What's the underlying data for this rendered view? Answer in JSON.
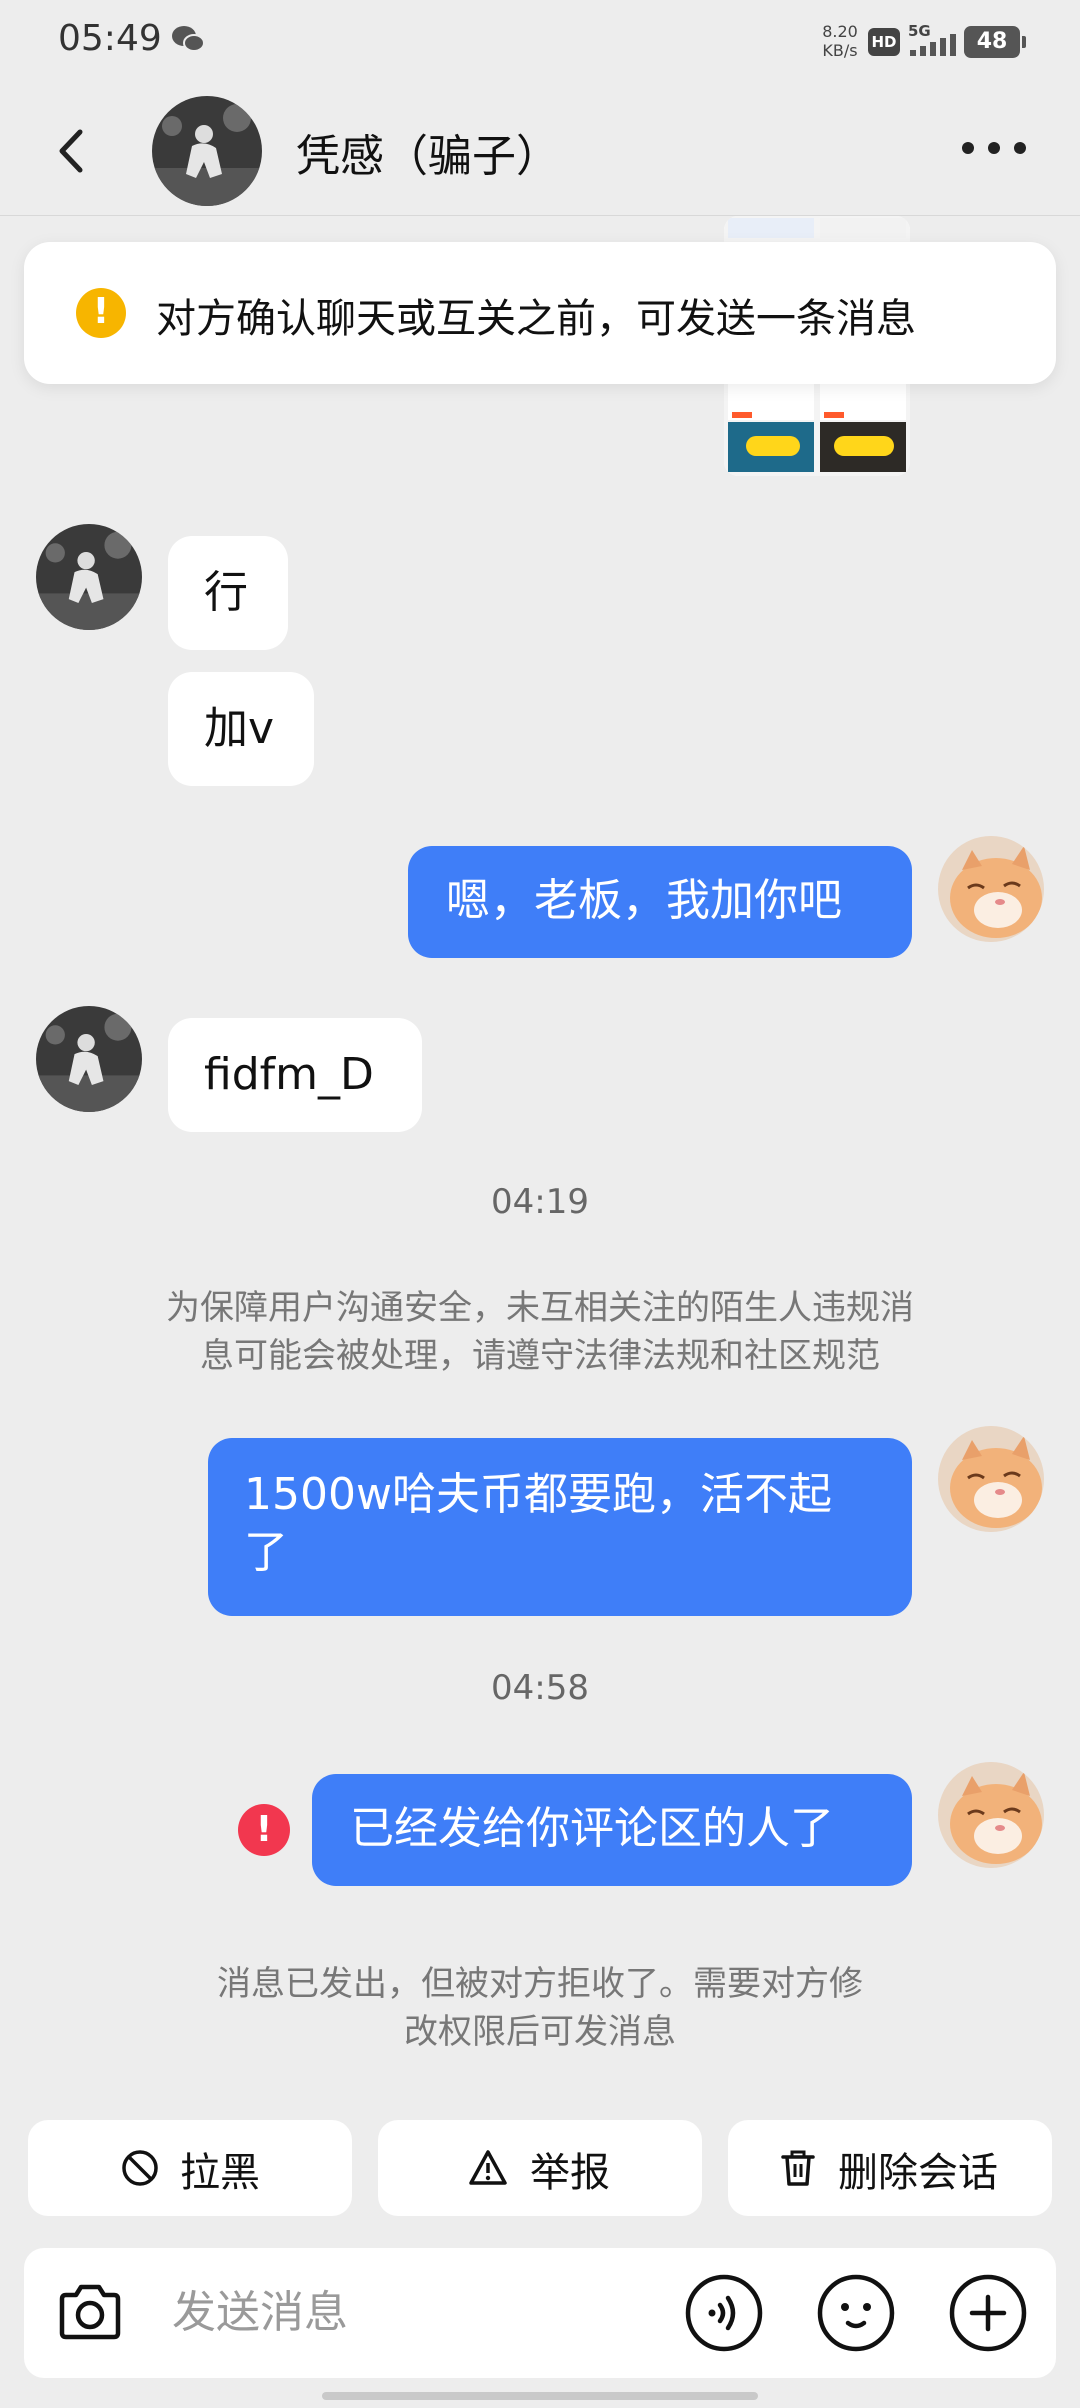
{
  "status_bar": {
    "time": "05:49",
    "net_speed_value": "8.20",
    "net_speed_unit": "KB/s",
    "hd_badge": "HD",
    "network": "5G",
    "battery": "48"
  },
  "header": {
    "title": "凭感（骗子）"
  },
  "notice": {
    "text": "对方确认聊天或互关之前，可发送一条消息"
  },
  "messages": {
    "m1": "行",
    "m2": "加v",
    "m3": "嗯，老板，我加你吧",
    "m4": "fidfm_D",
    "ts1": "04:19",
    "sys1_line1": "为保障用户沟通安全，未互相关注的陌生人违规消",
    "sys1_line2": "息可能会被处理，请遵守法律法规和社区规范",
    "m5_line1": "1500w哈夫币都要跑，活不起",
    "m5_line2": "了",
    "ts2": "04:58",
    "m6": "已经发给你评论区的人了",
    "sys2_line1": "消息已发出，但被对方拒收了。需要对方修",
    "sys2_line2": "改权限后可发消息"
  },
  "actions": {
    "block": "拉黑",
    "report": "举报",
    "delete": "删除会话"
  },
  "input": {
    "placeholder": "发送消息"
  },
  "colors": {
    "accent_blue": "#3f7ef8",
    "warning_yellow": "#f7b500",
    "error_red": "#f2374f",
    "background": "#ededed"
  }
}
